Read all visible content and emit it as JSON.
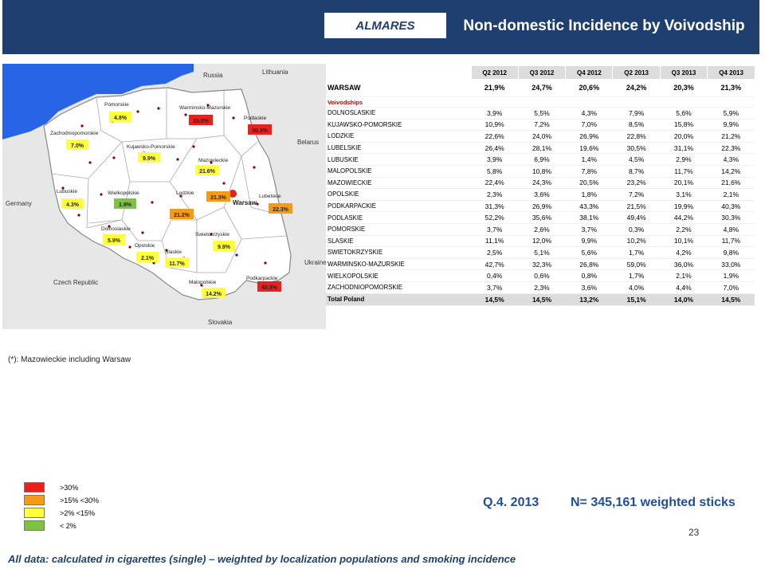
{
  "header": {
    "brand": "ALMARES",
    "title": "Non-domestic Incidence by Voivodship"
  },
  "colors": {
    "header_bg": "#1e3f70",
    "red": "#e8211c",
    "orange": "#f39a16",
    "yellow": "#ffff3b",
    "green": "#7dc242",
    "sea": "#2864e6"
  },
  "map": {
    "countries": {
      "russia": "Russia",
      "lithuania": "Lithuania",
      "belarus": "Belarus",
      "germany": "Germany",
      "ukraine": "Ukraine",
      "czech": "Czech Republic",
      "slovakia": "Slovakia"
    },
    "capital": "Warsaw",
    "regions": [
      {
        "name": "Pomorskie",
        "value": "4.8%",
        "level": "yellow"
      },
      {
        "name": "Warminsko-Mazurskie",
        "value": "33.0%",
        "level": "red"
      },
      {
        "name": "Podlaskie",
        "value": "30.3%",
        "level": "red"
      },
      {
        "name": "Zachodniopomorskie",
        "value": "7.0%",
        "level": "yellow"
      },
      {
        "name": "Kujawsko-Pomorskie",
        "value": "9.9%",
        "level": "yellow"
      },
      {
        "name": "Mazowieckie",
        "value": "21.6%",
        "level": "orange"
      },
      {
        "name": "Lubuskie",
        "value": "4.3%",
        "level": "yellow"
      },
      {
        "name": "Wielkopolskie",
        "value": "1.9%",
        "level": "green"
      },
      {
        "name": "Lodzkie",
        "value": "21.2%",
        "level": "orange"
      },
      {
        "name": "Warszawa",
        "value": "21.3%",
        "level": "orange"
      },
      {
        "name": "Lubelskie",
        "value": "22.3%",
        "level": "orange"
      },
      {
        "name": "Dolnoslaskie",
        "value": "5.9%",
        "level": "yellow"
      },
      {
        "name": "Opolskie",
        "value": "2.1%",
        "level": "yellow"
      },
      {
        "name": "Slaskie",
        "value": "11.7%",
        "level": "yellow"
      },
      {
        "name": "Swietokrzyskie",
        "value": "9.8%",
        "level": "yellow"
      },
      {
        "name": "Malopolskie",
        "value": "14.2%",
        "level": "yellow"
      },
      {
        "name": "Podkarpackie",
        "value": "40.3%",
        "level": "red"
      }
    ]
  },
  "table": {
    "headers": [
      "Q2 2012",
      "Q3 2012",
      "Q4 2012",
      "Q2 2013",
      "Q3 2013",
      "Q4 2013"
    ],
    "warsaw": {
      "name": "WARSAW",
      "values": [
        "21,9%",
        "24,7%",
        "20,6%",
        "24,2%",
        "20,3%",
        "21,3%"
      ]
    },
    "voivodships_label": "Voivodships",
    "rows": [
      {
        "name": "DOLNOSLASKIE",
        "values": [
          "3,9%",
          "5,5%",
          "4,3%",
          "7,9%",
          "5,6%",
          "5,9%"
        ]
      },
      {
        "name": "KUJAWSKO-POMORSKIE",
        "values": [
          "10,9%",
          "7,2%",
          "7,0%",
          "8,5%",
          "15,8%",
          "9,9%"
        ]
      },
      {
        "name": "LODZKIE",
        "values": [
          "22,6%",
          "24,0%",
          "26,9%",
          "22,8%",
          "20,0%",
          "21,2%"
        ]
      },
      {
        "name": "LUBELSKIE",
        "values": [
          "26,4%",
          "28,1%",
          "19,6%",
          "30,5%",
          "31,1%",
          "22,3%"
        ]
      },
      {
        "name": "LUBUSKIE",
        "values": [
          "3,9%",
          "6,9%",
          "1,4%",
          "4,5%",
          "2,9%",
          "4,3%"
        ]
      },
      {
        "name": "MALOPOLSKIE",
        "values": [
          "5,8%",
          "10,8%",
          "7,8%",
          "8,7%",
          "11,7%",
          "14,2%"
        ]
      },
      {
        "name": "MAZOWIECKIE",
        "values": [
          "22,4%",
          "24,3%",
          "20,5%",
          "23,2%",
          "20,1%",
          "21,6%"
        ]
      },
      {
        "name": "OPOLSKIE",
        "values": [
          "2,3%",
          "3,6%",
          "1,8%",
          "7,2%",
          "3,1%",
          "2,1%"
        ]
      },
      {
        "name": "PODKARPACKIE",
        "values": [
          "31,3%",
          "26,9%",
          "43,3%",
          "21,5%",
          "19,9%",
          "40,3%"
        ]
      },
      {
        "name": "PODLASKIE",
        "values": [
          "52,2%",
          "35,6%",
          "38,1%",
          "49,4%",
          "44,2%",
          "30,3%"
        ]
      },
      {
        "name": "POMORSKIE",
        "values": [
          "3,7%",
          "2,6%",
          "3,7%",
          "0,3%",
          "2,2%",
          "4,8%"
        ]
      },
      {
        "name": "SLASKIE",
        "values": [
          "11,1%",
          "12,0%",
          "9,9%",
          "10,2%",
          "10,1%",
          "11,7%"
        ]
      },
      {
        "name": "SWIETOKRZYSKIE",
        "values": [
          "2,5%",
          "5,1%",
          "5,6%",
          "1,7%",
          "4,2%",
          "9,8%"
        ]
      },
      {
        "name": "WARMINSKO-MAZURSKIE",
        "values": [
          "42,7%",
          "32,3%",
          "26,8%",
          "59,0%",
          "36,0%",
          "33,0%"
        ]
      },
      {
        "name": "WIELKOPOLSKIE",
        "values": [
          "0,4%",
          "0,6%",
          "0,8%",
          "1,7%",
          "2,1%",
          "1,9%"
        ]
      },
      {
        "name": "ZACHODNIOPOMORSKIE",
        "values": [
          "3,7%",
          "2,3%",
          "3,6%",
          "4,0%",
          "4,4%",
          "7,0%"
        ]
      }
    ],
    "total": {
      "name": "Total Poland",
      "values": [
        "14,5%",
        "14,5%",
        "13,2%",
        "15,1%",
        "14,0%",
        "14,5%"
      ]
    }
  },
  "note": "(*): Mazowieckie including Warsaw",
  "legend": [
    {
      "label": ">30%",
      "color": "#e8211c"
    },
    {
      "label": ">15% <30%",
      "color": "#f39a16"
    },
    {
      "label": ">2% <15%",
      "color": "#ffff3b"
    },
    {
      "label": "< 2%",
      "color": "#7dc242"
    }
  ],
  "summary": {
    "quarter": "Q.4. 2013",
    "sample": "N= 345,161  weighted sticks"
  },
  "page_number": "23",
  "footer": "All data: calculated in cigarettes (single) – weighted by localization populations and  smoking incidence"
}
